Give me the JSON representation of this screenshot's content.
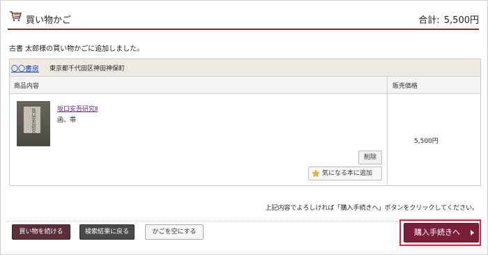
{
  "header": {
    "title": "買い物かご",
    "total_label": "合計:",
    "total_value": "5,500円"
  },
  "message": "古書 太郎様の買い物かごに追加しました。",
  "store": {
    "name": "〇〇書房",
    "address": "東京都千代田区神田神保町"
  },
  "table": {
    "col_product": "商品内容",
    "col_price": "販売価格"
  },
  "item": {
    "cover_text": "坂口安吾研究",
    "title": "坂口安吾研究Ⅱ",
    "condition": "函、帯",
    "price": "5,500円",
    "delete_label": "削除",
    "favorite_label": "気になる本に追加"
  },
  "instruction": "上記内容でよろしければ「購入手続きへ」ボタンをクリックしてください。",
  "buttons": {
    "continue": "買い物を続ける",
    "back_to_results": "検索結果に戻る",
    "empty_cart": "かごを空にする",
    "purchase": "購入手続きへ"
  },
  "icons": {
    "cart": "cart-icon",
    "star": "star-icon",
    "arrow": "arrow-right-icon"
  },
  "colors": {
    "accent": "#6b3a2a",
    "purchase": "#7a1f3a",
    "highlight": "#e0223b",
    "link": "#1a3fa8"
  }
}
